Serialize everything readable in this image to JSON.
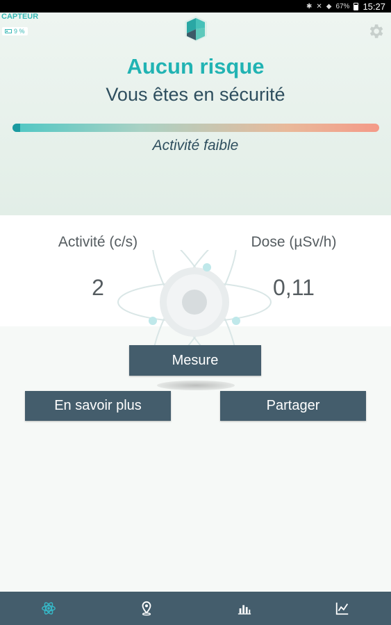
{
  "status_bar": {
    "battery_percent": "67%",
    "time": "15:27"
  },
  "sensor": {
    "label": "CAPTEUR",
    "battery": "9 %"
  },
  "risk": {
    "title": "Aucun risque",
    "subtitle": "Vous êtes en sécurité",
    "activity_level_text": "Activité faible",
    "gauge_level": 0.02
  },
  "measurements": {
    "activity_label": "Activité (c/s)",
    "activity_value": "2",
    "dose_label": "Dose (µSv/h)",
    "dose_value": "0,11"
  },
  "buttons": {
    "measure": "Mesure",
    "learn_more": "En savoir plus",
    "share": "Partager"
  },
  "bottom_nav": {
    "items": [
      "atom-icon",
      "map-pin-icon",
      "bar-chart-icon",
      "line-chart-icon"
    ],
    "active_color": "#36b7c6",
    "icon_color": "#ffffff"
  },
  "colors": {
    "accent": "#21b3b3",
    "button": "#445d6c",
    "text_dark": "#2e4e5e"
  }
}
